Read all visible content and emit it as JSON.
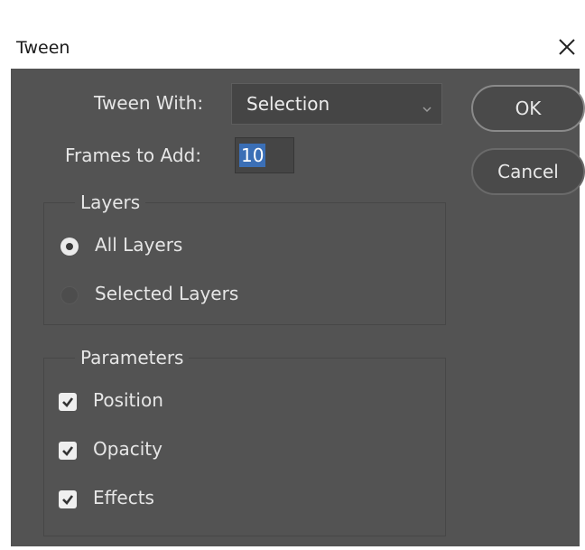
{
  "dialog": {
    "title": "Tween",
    "tween_with": {
      "label": "Tween With:",
      "value": "Selection"
    },
    "frames_to_add": {
      "label": "Frames to Add:",
      "value": "10"
    },
    "buttons": {
      "ok": "OK",
      "cancel": "Cancel"
    },
    "layers": {
      "legend": "Layers",
      "options": [
        {
          "label": "All Layers",
          "selected": true
        },
        {
          "label": "Selected Layers",
          "selected": false
        }
      ]
    },
    "parameters": {
      "legend": "Parameters",
      "options": [
        {
          "label": "Position",
          "checked": true
        },
        {
          "label": "Opacity",
          "checked": true
        },
        {
          "label": "Effects",
          "checked": true
        }
      ]
    }
  },
  "colors": {
    "dialog_background": "#535353",
    "title_bar": "#ffffff",
    "text": "#e6e6e6",
    "selection_highlight": "#3b6fb6"
  },
  "icons": {
    "close": "close-icon",
    "dropdown": "chevron-down-icon",
    "checkmark": "checkmark-icon"
  }
}
